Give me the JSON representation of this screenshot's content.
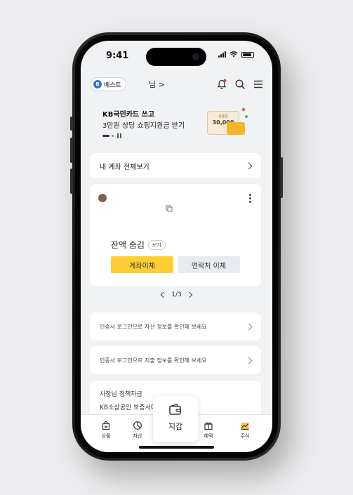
{
  "status_bar": {
    "time": "9:41"
  },
  "header": {
    "grade_badge": "B",
    "grade_label": "베스트",
    "username": "님 >"
  },
  "banner": {
    "title": "KB국민카드 쓰고",
    "subtitle": "3만원 상당 쇼핑지원금 받기",
    "gift_card_label": "상품권",
    "gift_card_amount": "30,000"
  },
  "all_accounts_link": "내 계좌 전체보기",
  "account_card": {
    "balance_text": "잔액 숨김",
    "view_label": "보기",
    "transfer_button": "계좌이체",
    "contact_transfer_button": "연락처 이체",
    "pager": "1/3"
  },
  "login_asset_prompt": "인증서 로그인으로 자산 정보를 확인해 보세요",
  "login_spending_prompt": "인증서 로그인으로 지출 정보를 확인해 보세요",
  "promo": {
    "line1": "사장님 정책자금",
    "line2": "KB소상공인 보증서대"
  },
  "tabbar": {
    "products": "상품",
    "assets": "자산",
    "wallet": "지갑",
    "benefits": "혜택",
    "stocks": "주식"
  },
  "colors": {
    "accent_yellow": "#ffce33",
    "grade_blue": "#3b6de0",
    "notification_dot": "#e53935"
  }
}
